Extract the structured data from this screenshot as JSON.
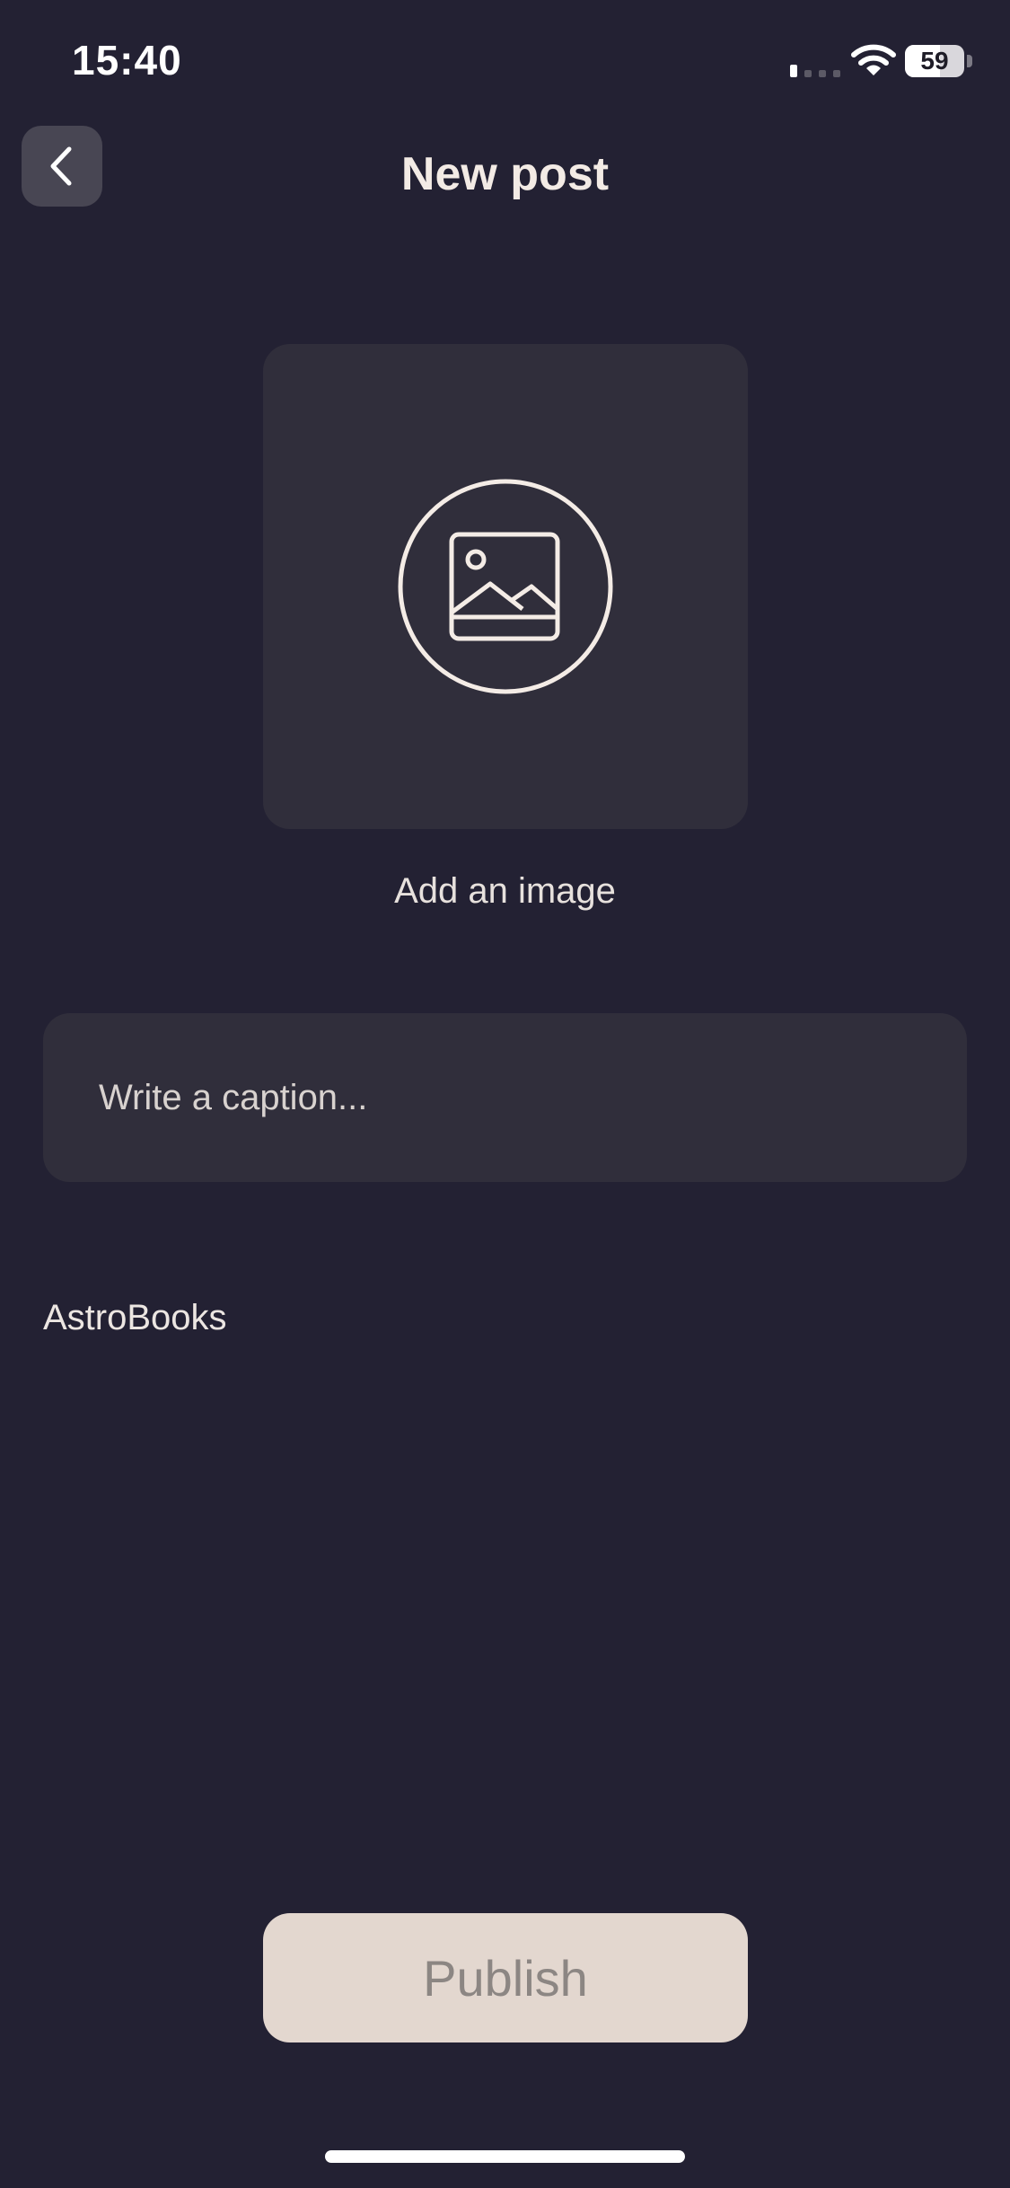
{
  "status_bar": {
    "time": "15:40",
    "battery_level": "59",
    "battery_fraction": 0.59
  },
  "header": {
    "title": "New post",
    "back_icon": "chevron-left-icon"
  },
  "image_picker": {
    "icon": "image-placeholder-icon",
    "label": "Add an image"
  },
  "caption": {
    "value": "",
    "placeholder": "Write a caption..."
  },
  "community": {
    "name": "AstroBooks"
  },
  "actions": {
    "publish_label": "Publish"
  },
  "colors": {
    "background": "#232133",
    "surface": "#302e3b",
    "text": "#f1ebe6",
    "button_bg": "#e3d7cf",
    "button_text": "#8c8683"
  }
}
